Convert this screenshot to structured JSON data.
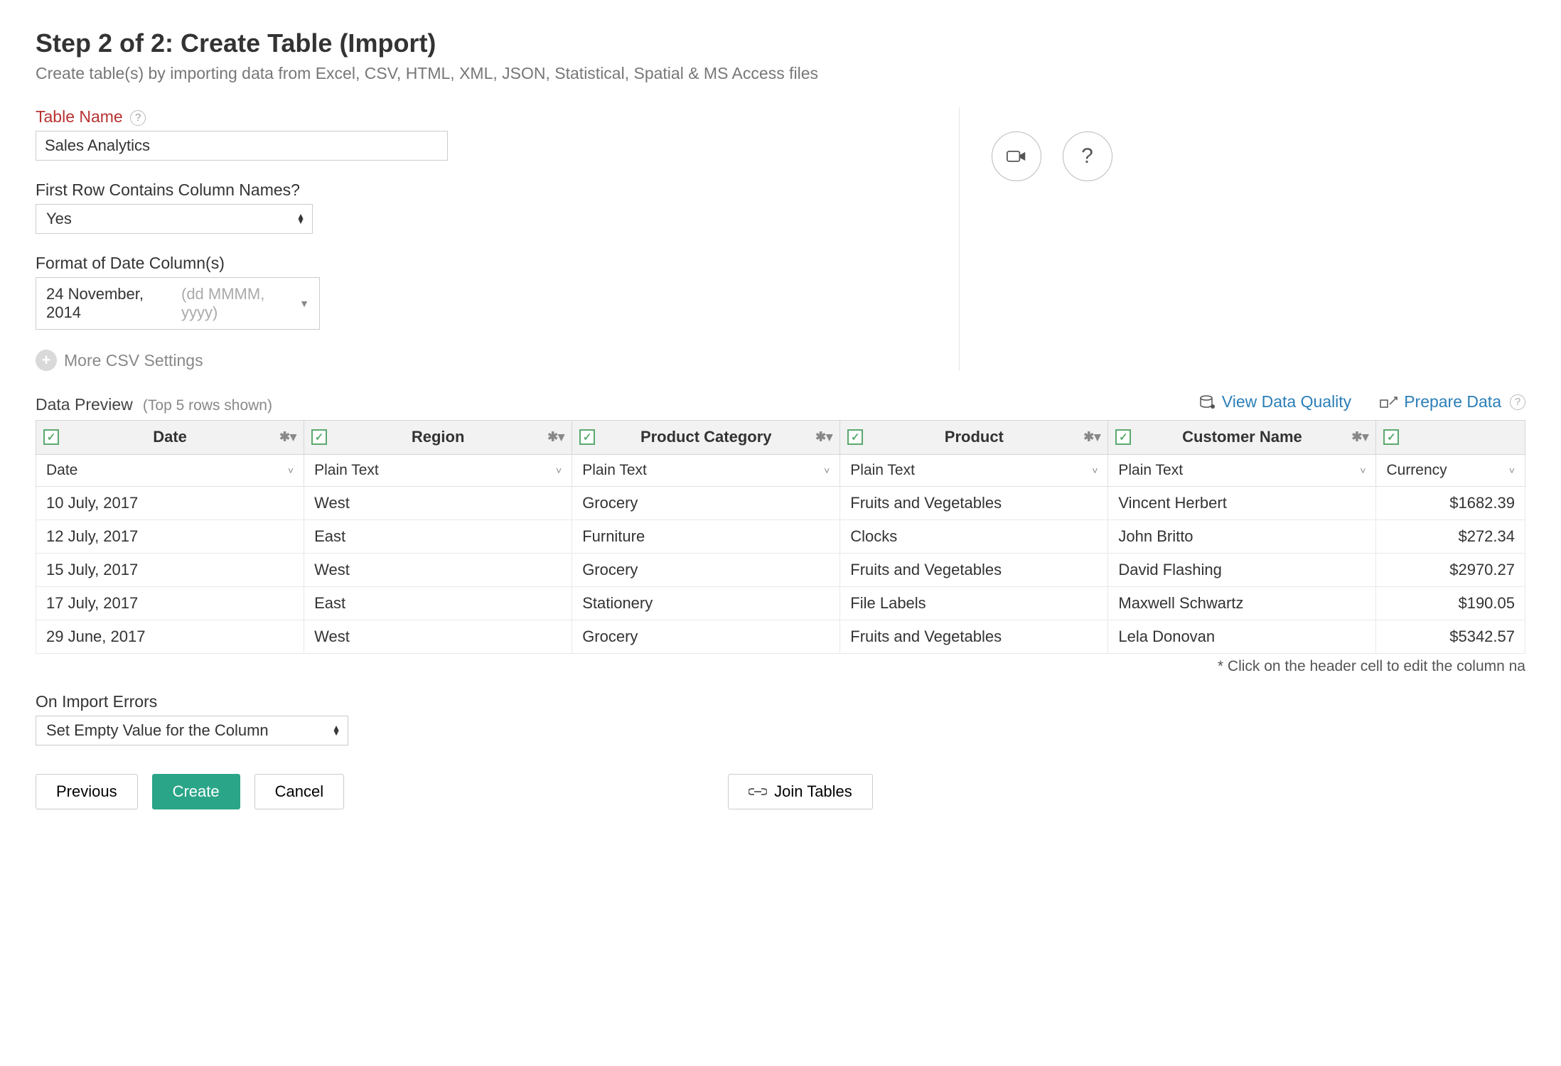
{
  "header": {
    "title": "Step 2 of 2: Create Table (Import)",
    "subtitle": "Create table(s) by importing data from Excel, CSV, HTML, XML, JSON, Statistical, Spatial & MS Access files"
  },
  "form": {
    "table_name_label": "Table Name",
    "table_name_value": "Sales Analytics",
    "first_row_label": "First Row Contains Column Names?",
    "first_row_value": "Yes",
    "date_format_label": "Format of Date Column(s)",
    "date_format_value": "24 November, 2014",
    "date_format_hint": "(dd MMMM, yyyy)",
    "more_csv_label": "More CSV Settings"
  },
  "preview": {
    "title": "Data Preview",
    "subtitle": "(Top 5 rows shown)",
    "links": {
      "view_dq": "View Data Quality",
      "prepare": "Prepare Data"
    },
    "columns": [
      {
        "name": "Date",
        "type": "Date"
      },
      {
        "name": "Region",
        "type": "Plain Text"
      },
      {
        "name": "Product Category",
        "type": "Plain Text"
      },
      {
        "name": "Product",
        "type": "Plain Text"
      },
      {
        "name": "Customer Name",
        "type": "Plain Text"
      },
      {
        "name": "",
        "type": "Currency"
      }
    ],
    "col_widths": [
      "18%",
      "18%",
      "18%",
      "18%",
      "18%",
      "10%"
    ],
    "rows": [
      [
        "10 July, 2017",
        "West",
        "Grocery",
        "Fruits and Vegetables",
        "Vincent Herbert",
        "$1682.39"
      ],
      [
        "12 July, 2017",
        "East",
        "Furniture",
        "Clocks",
        "John Britto",
        "$272.34"
      ],
      [
        "15 July, 2017",
        "West",
        "Grocery",
        "Fruits and Vegetables",
        "David Flashing",
        "$2970.27"
      ],
      [
        "17 July, 2017",
        "East",
        "Stationery",
        "File Labels",
        "Maxwell Schwartz",
        "$190.05"
      ],
      [
        "29 June, 2017",
        "West",
        "Grocery",
        "Fruits and Vegetables",
        "Lela Donovan",
        "$5342.57"
      ]
    ],
    "footer_hint": "* Click on the header cell to edit the column na"
  },
  "errors": {
    "label": "On Import Errors",
    "value": "Set Empty Value for the Column"
  },
  "buttons": {
    "previous": "Previous",
    "create": "Create",
    "cancel": "Cancel",
    "join": "Join Tables"
  }
}
